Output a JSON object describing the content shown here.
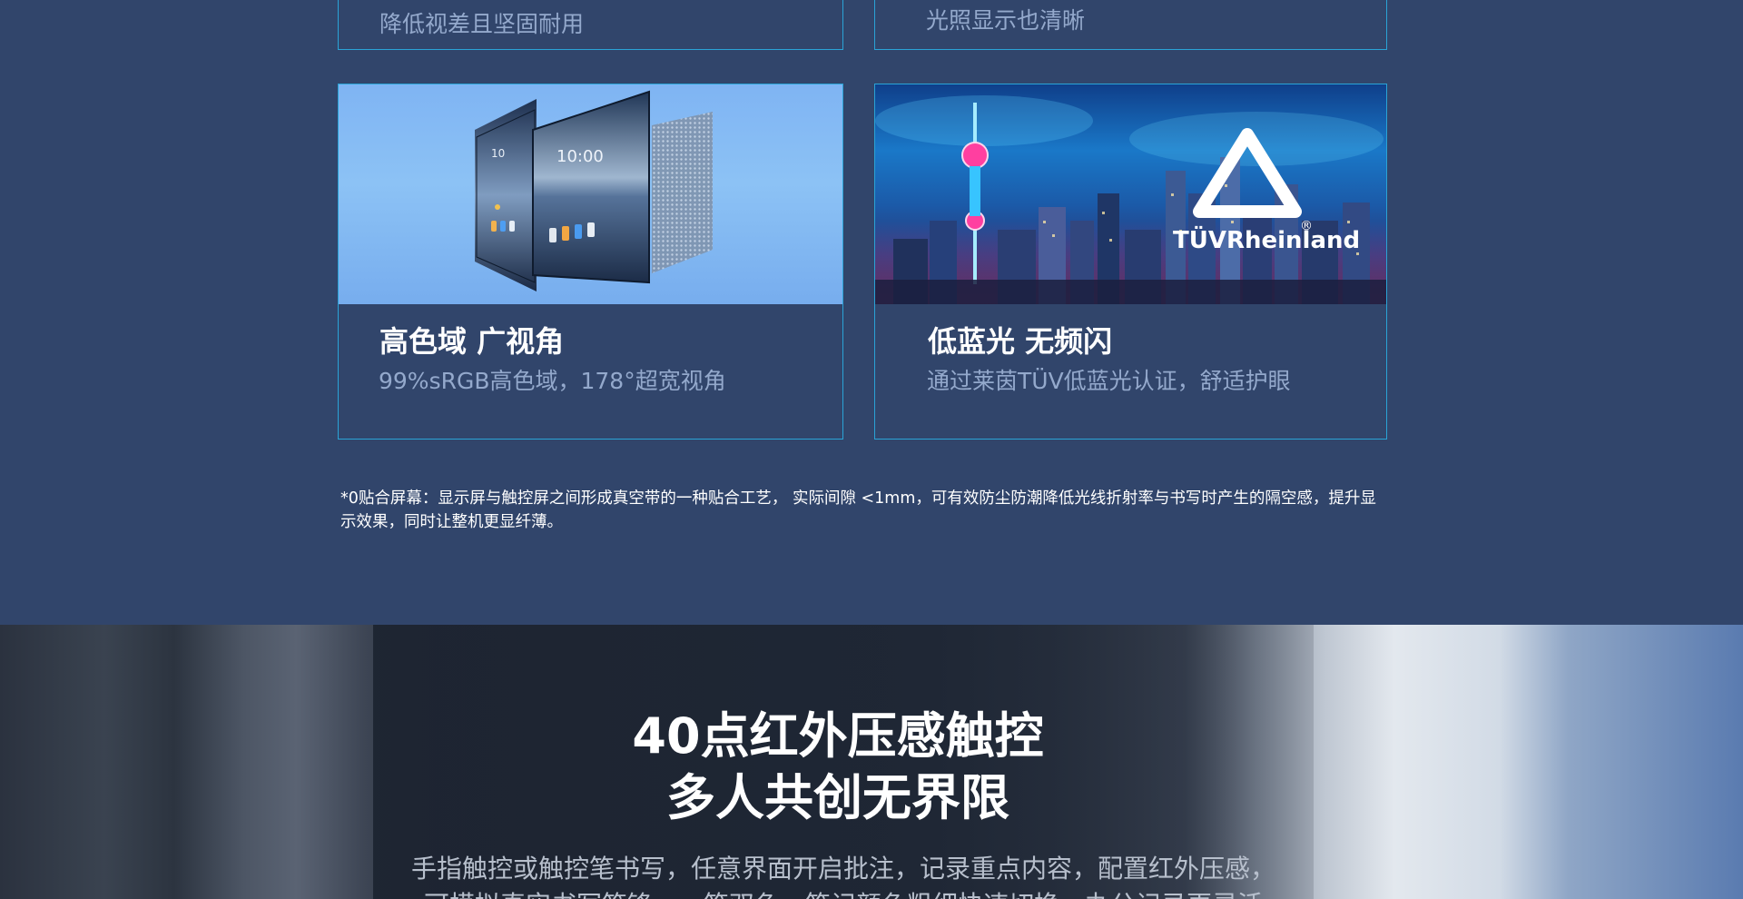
{
  "cards": {
    "top_left_sub": "降低视差且坚固耐用",
    "top_right_sub": "光照显示也清晰",
    "color_gamut": {
      "title": "高色域 广视角",
      "desc": "99%sRGB高色域，178°超宽视角",
      "screen_time": "10:00"
    },
    "low_blue": {
      "title": "低蓝光 无频闪",
      "desc": "通过莱茵TÜV低蓝光认证，舒适护眼",
      "logo_text": "TÜVRheinland",
      "logo_mark": "®"
    }
  },
  "footnote": "*0贴合屏幕：显示屏与触控屏之间形成真空带的一种贴合工艺， 实际间隙 <1mm，可有效防尘防潮降低光线折射率与书写时产生的隔空感，提升显示效果，同时让整机更显纤薄。",
  "touch_section": {
    "title_line1": "40点红外压感触控",
    "title_line2": "多人共创无界限",
    "desc_line1": "手指触控或触控笔书写，任意界面开启批注，记录重点内容，配置红外压感，",
    "desc_line2": "可模拟真实书写笔锋，一笔双色，笔记颜色粗细快速切换，办公记录更灵活"
  },
  "colors": {
    "page_bg": "#31456b",
    "card_border": "#2aa3d6",
    "subtitle": "#94a9cc"
  }
}
